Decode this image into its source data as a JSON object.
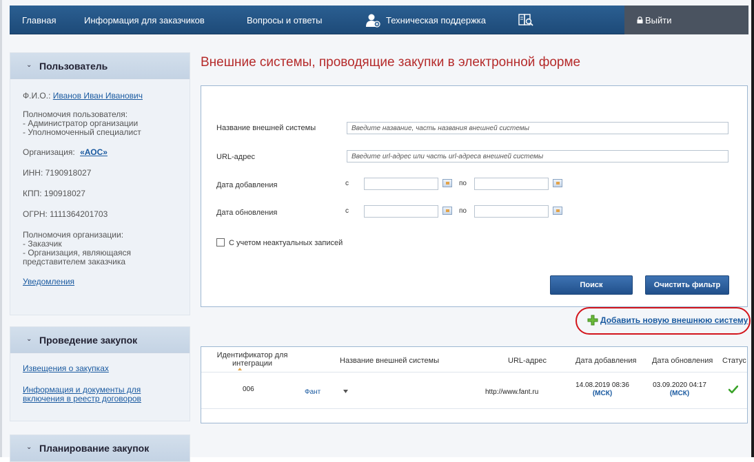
{
  "nav": {
    "home": "Главная",
    "info": "Информация для заказчиков",
    "faq": "Вопросы и ответы",
    "support": "Техническая поддержка",
    "logout": "Выйти"
  },
  "sidebar": {
    "user": {
      "title": "Пользователь",
      "fio_label": "Ф.И.О.:",
      "fio_value": "Иванов Иван Иванович",
      "powers_title": "Полномочия пользователя:",
      "powers": [
        "- Администратор организации",
        "- Уполномоченный специалист"
      ],
      "org_label": "Организация:",
      "org_value": "«АОС»",
      "inn": "ИНН: 7190918027",
      "kpp": "КПП: 190918027",
      "ogrn": "ОГРН: 1111364201703",
      "org_powers_title": "Полномочия организации:",
      "org_powers": [
        "- Заказчик",
        "- Организация, являющаяся",
        "представителем заказчика"
      ],
      "notifications": "Уведомления"
    },
    "procurement": {
      "title": "Проведение закупок",
      "links": [
        "Извещения о закупках",
        "Информация и документы для",
        "включения в реестр договоров"
      ]
    },
    "planning": {
      "title": "Планирование закупок"
    }
  },
  "page": {
    "title": "Внешние системы, проводящие закупки в электронной форме"
  },
  "filter": {
    "name_label": "Название внешней системы",
    "name_placeholder": "Введите название, часть названия внешней системы",
    "url_label": "URL-адрес",
    "url_placeholder": "Введите url-адрес или часть url-адреса внешней системы",
    "added_label": "Дата добавления",
    "updated_label": "Дата обновления",
    "from": "с",
    "to": "по",
    "inactive_label": "С учетом неактуальных записей",
    "search_btn": "Поиск",
    "clear_btn": "Очистить фильтр"
  },
  "add_link": "Добавить новую внешнюю систему",
  "table": {
    "headers": {
      "id_line1": "Идентификатор для",
      "id_line2": "интеграции",
      "name": "Название внешней системы",
      "url": "URL-адрес",
      "added": "Дата добавления",
      "updated": "Дата обновления",
      "status": "Статус"
    },
    "rows": [
      {
        "id": "006",
        "name": "Фант",
        "url": "http://www.fant.ru",
        "added": "14.08.2019 08:36",
        "updated": "03.09.2020 04:17",
        "tz": "(МСК)"
      }
    ]
  },
  "colors": {
    "nav_bg": "#1d4a78",
    "title_red": "#b52b2b",
    "link_blue": "#1a5aa0",
    "highlight_red": "#d3141b",
    "status_green": "#3aa32a"
  }
}
